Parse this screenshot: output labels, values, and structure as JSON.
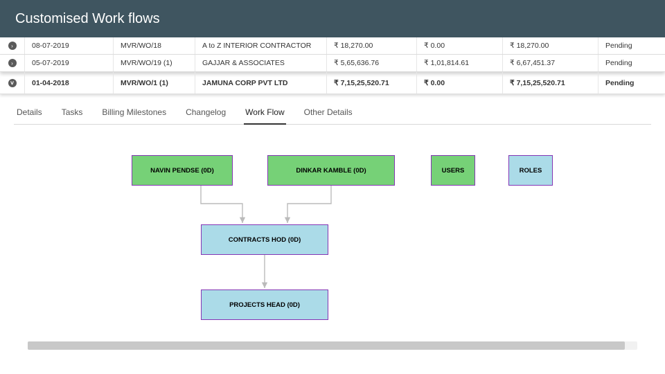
{
  "header": {
    "title": "Customised Work flows"
  },
  "table": {
    "rows": [
      {
        "expanded": false,
        "date": "08-07-2019",
        "ref": "MVR/WO/18",
        "vendor": "A to Z INTERIOR CONTRACTOR",
        "amount1": "₹ 18,270.00",
        "amount2": "₹ 0.00",
        "amount3": "₹ 18,270.00",
        "status": "Pending"
      },
      {
        "expanded": false,
        "date": "05-07-2019",
        "ref": "MVR/WO/19 (1)",
        "vendor": "GAJJAR & ASSOCIATES",
        "amount1": "₹ 5,65,636.76",
        "amount2": "₹ 1,01,814.61",
        "amount3": "₹ 6,67,451.37",
        "status": "Pending"
      },
      {
        "expanded": true,
        "date": "01-04-2018",
        "ref": "MVR/WO/1 (1)",
        "vendor": "JAMUNA CORP PVT LTD",
        "amount1": "₹ 7,15,25,520.71",
        "amount2": "₹ 0.00",
        "amount3": "₹ 7,15,25,520.71",
        "status": "Pending"
      }
    ]
  },
  "tabs": {
    "items": [
      {
        "label": "Details"
      },
      {
        "label": "Tasks"
      },
      {
        "label": "Billing Milestones"
      },
      {
        "label": "Changelog"
      },
      {
        "label": "Work Flow",
        "active": true
      },
      {
        "label": "Other Details"
      }
    ]
  },
  "workflow": {
    "nodes": {
      "n1": "NAVIN PENDSE (0D)",
      "n2": "DINKAR KAMBLE (0D)",
      "n3": "USERS",
      "n4": "ROLES",
      "n5": "CONTRACTS HOD (0D)",
      "n6": "PROJECTS HEAD (0D)"
    }
  },
  "icons": {
    "collapsed": "›",
    "expanded": "ⅴ"
  }
}
